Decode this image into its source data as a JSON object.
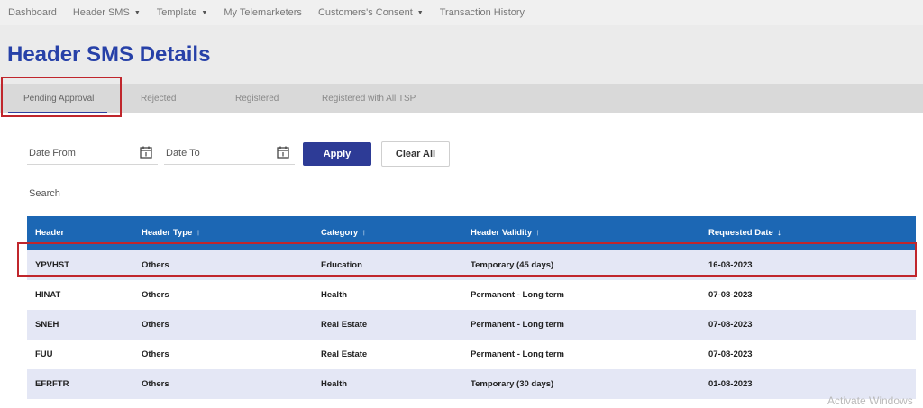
{
  "nav": {
    "items": [
      {
        "label": "Dashboard",
        "dropdown": false
      },
      {
        "label": "Header SMS",
        "dropdown": true
      },
      {
        "label": "Template",
        "dropdown": true
      },
      {
        "label": "My Telemarketers",
        "dropdown": false
      },
      {
        "label": "Customers's Consent",
        "dropdown": true
      },
      {
        "label": "Transaction History",
        "dropdown": false
      }
    ]
  },
  "page": {
    "title": "Header SMS Details"
  },
  "tabs": [
    {
      "label": "Pending Approval",
      "active": true
    },
    {
      "label": "Rejected",
      "active": false
    },
    {
      "label": "Registered",
      "active": false
    },
    {
      "label": "Registered with All TSP",
      "active": false
    }
  ],
  "filters": {
    "date_from_label": "Date From",
    "date_to_label": "Date To",
    "apply_label": "Apply",
    "clear_label": "Clear All",
    "search_label": "Search"
  },
  "table": {
    "columns": [
      {
        "label": "Header",
        "sort": ""
      },
      {
        "label": "Header Type",
        "sort": "↑"
      },
      {
        "label": "Category",
        "sort": "↑"
      },
      {
        "label": "Header Validity",
        "sort": "↑"
      },
      {
        "label": "Requested Date",
        "sort": "↓"
      }
    ],
    "rows": [
      [
        "YPVHST",
        "Others",
        "Education",
        "Temporary (45 days)",
        "16-08-2023"
      ],
      [
        "HINAT",
        "Others",
        "Health",
        "Permanent - Long term",
        "07-08-2023"
      ],
      [
        "SNEH",
        "Others",
        "Real Estate",
        "Permanent - Long term",
        "07-08-2023"
      ],
      [
        "FUU",
        "Others",
        "Real Estate",
        "Permanent - Long term",
        "07-08-2023"
      ],
      [
        "EFRFTR",
        "Others",
        "Health",
        "Temporary (30 days)",
        "01-08-2023"
      ]
    ]
  },
  "watermark": "Activate Windows",
  "colors": {
    "title": "#2741a8",
    "table_header": "#1c67b4",
    "apply_button": "#2d3b96",
    "highlight": "#c0262c",
    "row_alt": "#e4e7f5"
  }
}
